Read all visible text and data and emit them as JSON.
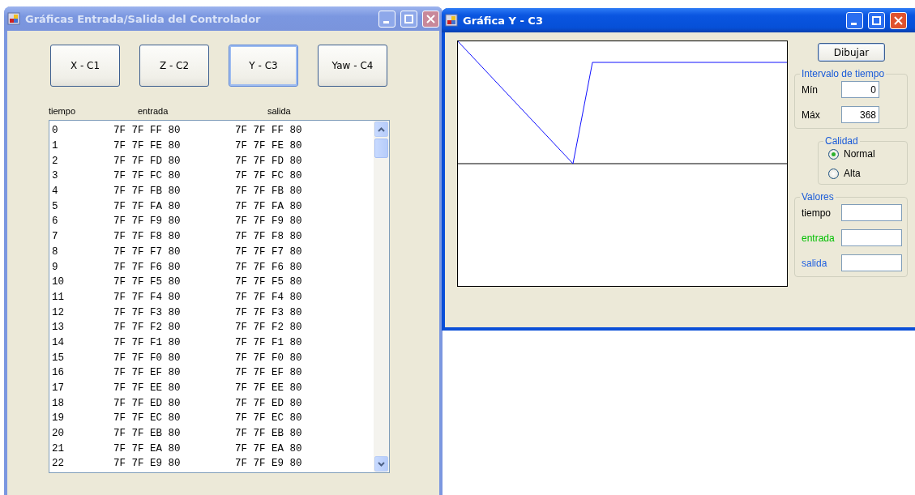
{
  "left_window": {
    "title": "Gráficas Entrada/Salida del Controlador",
    "active": false,
    "buttons": [
      {
        "label": "X - C1",
        "focused": false
      },
      {
        "label": "Z - C2",
        "focused": false
      },
      {
        "label": "Y - C3",
        "focused": true
      },
      {
        "label": "Yaw - C4",
        "focused": false
      }
    ],
    "columns": [
      "tiempo",
      "entrada",
      "salida"
    ],
    "rows": [
      {
        "tiempo": "0",
        "entrada": "7F 7F FF 80",
        "salida": "7F 7F FF 80"
      },
      {
        "tiempo": "1",
        "entrada": "7F 7F FE 80",
        "salida": "7F 7F FE 80"
      },
      {
        "tiempo": "2",
        "entrada": "7F 7F FD 80",
        "salida": "7F 7F FD 80"
      },
      {
        "tiempo": "3",
        "entrada": "7F 7F FC 80",
        "salida": "7F 7F FC 80"
      },
      {
        "tiempo": "4",
        "entrada": "7F 7F FB 80",
        "salida": "7F 7F FB 80"
      },
      {
        "tiempo": "5",
        "entrada": "7F 7F FA 80",
        "salida": "7F 7F FA 80"
      },
      {
        "tiempo": "6",
        "entrada": "7F 7F F9 80",
        "salida": "7F 7F F9 80"
      },
      {
        "tiempo": "7",
        "entrada": "7F 7F F8 80",
        "salida": "7F 7F F8 80"
      },
      {
        "tiempo": "8",
        "entrada": "7F 7F F7 80",
        "salida": "7F 7F F7 80"
      },
      {
        "tiempo": "9",
        "entrada": "7F 7F F6 80",
        "salida": "7F 7F F6 80"
      },
      {
        "tiempo": "10",
        "entrada": "7F 7F F5 80",
        "salida": "7F 7F F5 80"
      },
      {
        "tiempo": "11",
        "entrada": "7F 7F F4 80",
        "salida": "7F 7F F4 80"
      },
      {
        "tiempo": "12",
        "entrada": "7F 7F F3 80",
        "salida": "7F 7F F3 80"
      },
      {
        "tiempo": "13",
        "entrada": "7F 7F F2 80",
        "salida": "7F 7F F2 80"
      },
      {
        "tiempo": "14",
        "entrada": "7F 7F F1 80",
        "salida": "7F 7F F1 80"
      },
      {
        "tiempo": "15",
        "entrada": "7F 7F F0 80",
        "salida": "7F 7F F0 80"
      },
      {
        "tiempo": "16",
        "entrada": "7F 7F EF 80",
        "salida": "7F 7F EF 80"
      },
      {
        "tiempo": "17",
        "entrada": "7F 7F EE 80",
        "salida": "7F 7F EE 80"
      },
      {
        "tiempo": "18",
        "entrada": "7F 7F ED 80",
        "salida": "7F 7F ED 80"
      },
      {
        "tiempo": "19",
        "entrada": "7F 7F EC 80",
        "salida": "7F 7F EC 80"
      },
      {
        "tiempo": "20",
        "entrada": "7F 7F EB 80",
        "salida": "7F 7F EB 80"
      },
      {
        "tiempo": "21",
        "entrada": "7F 7F EA 80",
        "salida": "7F 7F EA 80"
      },
      {
        "tiempo": "22",
        "entrada": "7F 7F E9 80",
        "salida": "7F 7F E9 80"
      }
    ]
  },
  "right_window": {
    "title": "Gráfica Y - C3",
    "active": true,
    "draw_button": "Dibujar",
    "interval": {
      "title": "Intervalo de tiempo",
      "fields": [
        {
          "label": "Mín",
          "value": "0"
        },
        {
          "label": "Máx",
          "value": "368"
        }
      ]
    },
    "quality": {
      "title": "Calidad",
      "options": [
        {
          "label": "Normal",
          "selected": true
        },
        {
          "label": "Alta",
          "selected": false
        }
      ]
    },
    "values": {
      "title": "Valores",
      "fields": [
        {
          "label": "tiempo",
          "color": "#000000"
        },
        {
          "label": "entrada",
          "color": "#00c000"
        },
        {
          "label": "salida",
          "color": "#2060e0"
        }
      ]
    }
  }
}
